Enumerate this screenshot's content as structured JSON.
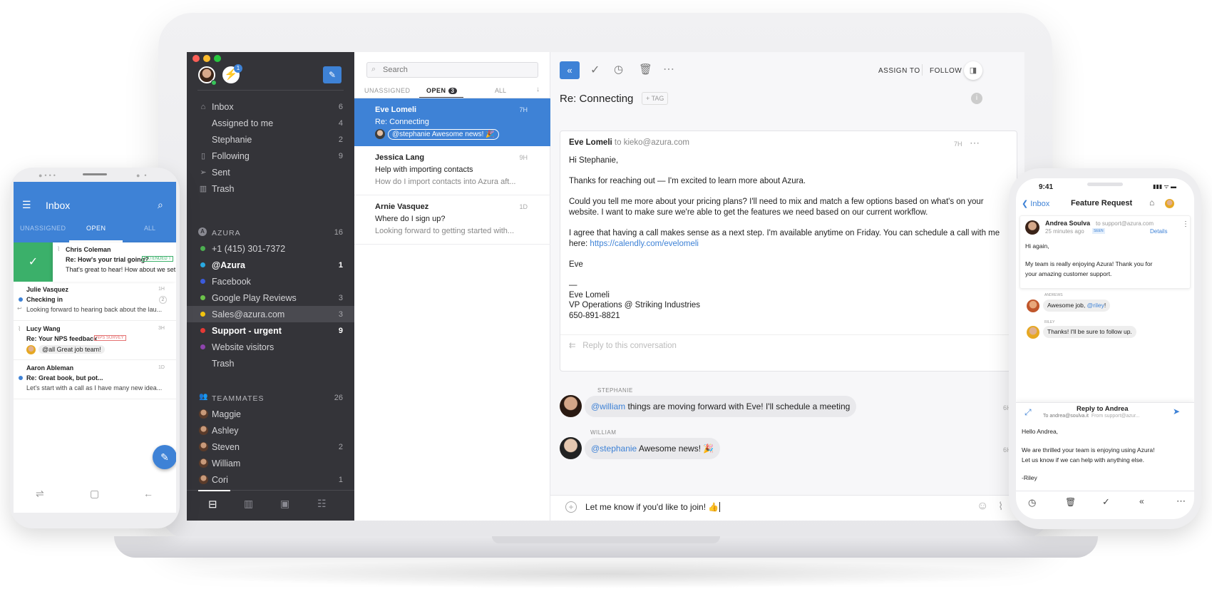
{
  "sidebar": {
    "notif_count": "1",
    "items": [
      {
        "label": "Inbox",
        "count": "6"
      },
      {
        "label": "Assigned to me",
        "count": "4"
      },
      {
        "label": "Stephanie",
        "count": "2"
      },
      {
        "label": "Following",
        "count": "9"
      },
      {
        "label": "Sent",
        "count": ""
      },
      {
        "label": "Trash",
        "count": ""
      }
    ],
    "azura_title": "AZURA",
    "azura_count": "16",
    "channels": [
      {
        "label": "+1 (415) 301-7372",
        "count": "",
        "color": "#4caf50"
      },
      {
        "label": "@Azura",
        "count": "1",
        "color": "#29a9e1"
      },
      {
        "label": "Facebook",
        "count": "",
        "color": "#3b5bdb"
      },
      {
        "label": "Google Play Reviews",
        "count": "3",
        "color": "#6cc24a"
      },
      {
        "label": "Sales@azura.com",
        "count": "3",
        "color": "#f1c40f"
      },
      {
        "label": "Support - urgent",
        "count": "9",
        "color": "#e53935"
      },
      {
        "label": "Website visitors",
        "count": "",
        "color": "#8e44ad"
      },
      {
        "label": "Trash",
        "count": "",
        "color": ""
      }
    ],
    "teammates_title": "TEAMMATES",
    "teammates_count": "26",
    "teammates": [
      {
        "label": "Maggie",
        "count": ""
      },
      {
        "label": "Ashley",
        "count": ""
      },
      {
        "label": "Steven",
        "count": "2"
      },
      {
        "label": "William",
        "count": ""
      },
      {
        "label": "Cori",
        "count": "1"
      }
    ]
  },
  "list": {
    "search_placeholder": "Search",
    "tabs": {
      "unassigned": "UNASSIGNED",
      "open": "OPEN",
      "open_count": "3",
      "all": "ALL"
    },
    "conversations": [
      {
        "name": "Eve Lomeli",
        "subject": "Re: Connecting",
        "time": "7H",
        "preview": "@stephanie Awesome news! 🎉"
      },
      {
        "name": "Jessica Lang",
        "subject": "Help with importing contacts",
        "time": "9H",
        "preview": "How do I import contacts into Azura aft..."
      },
      {
        "name": "Arnie Vasquez",
        "subject": "Where do I sign up?",
        "time": "1D",
        "preview": "Looking forward to getting started with..."
      }
    ]
  },
  "main": {
    "assign": "ASSIGN TO",
    "follow": "FOLLOW",
    "title": "Re: Connecting",
    "tag": "+ TAG",
    "message": {
      "from": "Eve Lomeli",
      "to": "to kieko@azura.com",
      "time": "7H",
      "lines": [
        "Hi Stephanie,",
        "Thanks for reaching out — I'm excited to learn more about Azura.",
        "Could you tell me more about your pricing plans? I'll need to mix and match a few options based on what's on your",
        "website. I want to make sure we're able to get the features we need based on our current workflow.",
        "I agree that having a call makes sense as a next step. I'm available anytime on Friday. You can schedule a call with me",
        "here:",
        "https://calendly.com/evelomeli",
        "Eve",
        "—",
        "Eve Lomeli",
        "VP Operations @ Striking Industries",
        "650-891-8821"
      ],
      "reply_placeholder": "Reply to this conversation"
    },
    "comments": [
      {
        "author": "STEPHANIE",
        "mention": "@william",
        "text": " things are moving forward with Eve! I'll schedule a meeting",
        "time": "6H"
      },
      {
        "author": "WILLIAM",
        "mention": "@stephanie",
        "text": " Awesome news! 🎉",
        "time": "6H"
      }
    ],
    "composer": "Let me know if you'd like to join! 👍"
  },
  "android": {
    "title": "Inbox",
    "tabs": [
      "UNASSIGNED",
      "OPEN",
      "ALL"
    ],
    "items": [
      {
        "name": "Chris Coleman",
        "subject": "Re: How's your trial going?",
        "badge": "EXTENDED T",
        "preview": "That's great to hear! How about we set",
        "time": ""
      },
      {
        "name": "Julie Vasquez",
        "subject": "Checking in",
        "badge": "",
        "preview": "Looking forward to hearing back about the lau...",
        "time": "1H",
        "count": "2"
      },
      {
        "name": "Lucy Wang",
        "subject": "Re: Your NPS feedback",
        "badge": "NPS SURVEY",
        "preview": "@all Great job team!",
        "time": "3H"
      },
      {
        "name": "Aaron Ableman",
        "subject": "Re: Great book, but pot...",
        "badge": "",
        "preview": "Let's start with a call as I have many new idea...",
        "time": "1D"
      }
    ]
  },
  "iphone": {
    "clock": "9:41",
    "back": "Inbox",
    "title": "Feature Request",
    "sender": "Andrea Soulva",
    "sender_to": "to support@azura.com",
    "ago": "25 minutes ago",
    "seen": "SEEN",
    "details": "Details",
    "body": [
      "Hi again,",
      "My team is really enjoying Azura! Thank you for",
      "your amazing customer support."
    ],
    "comments": [
      {
        "author": "ANDREWS",
        "pre": "Awesome job, ",
        "mention": "@riley",
        "post": "!"
      },
      {
        "author": "RILEY",
        "pre": "Thanks! I'll be sure to follow up.",
        "mention": "",
        "post": ""
      }
    ],
    "reply_title": "Reply to Andrea",
    "reply_to": "To andrea@soulva.it",
    "reply_from": "From support@azur...",
    "reply_body": [
      "Hello Andrea,",
      "We are thrilled your team is enjoying using Azura!",
      "Let us know if we can help with anything else.",
      "-Riley"
    ]
  }
}
